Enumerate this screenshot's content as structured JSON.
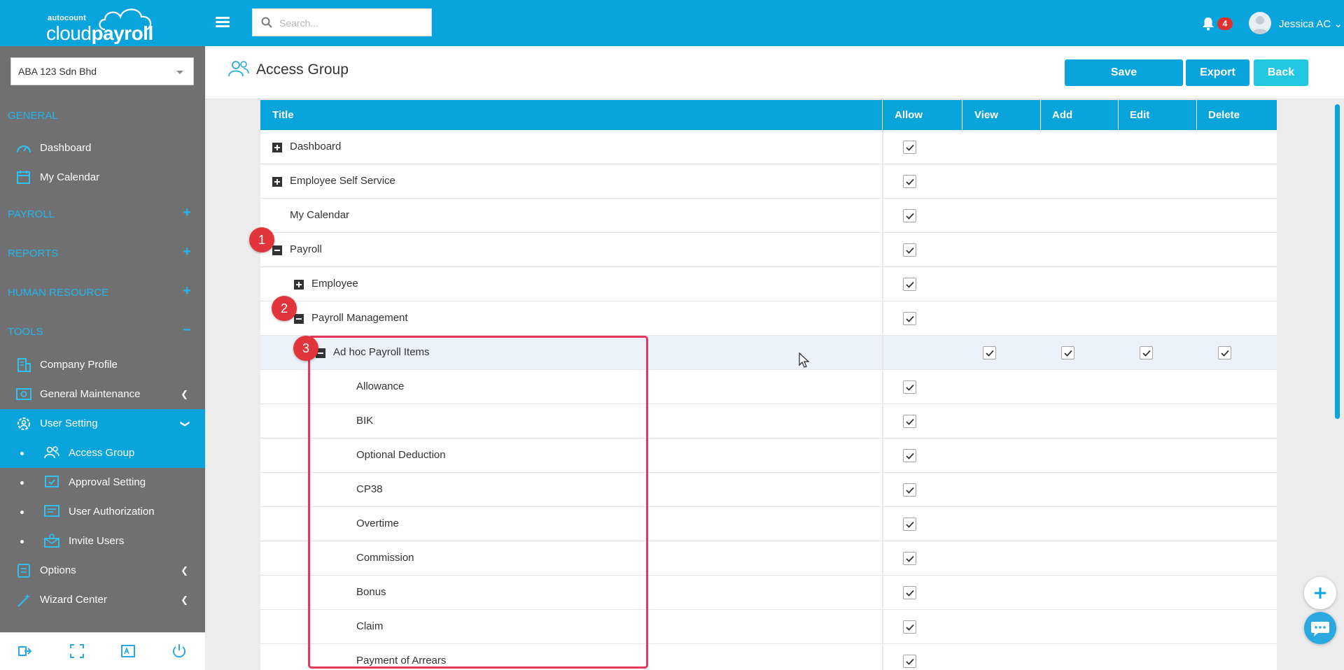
{
  "app": {
    "brand_small": "autocount",
    "brand_main_light": "cloud",
    "brand_main_bold": "payroll",
    "accent_color": "#0aa4dd",
    "sidebar_color": "#707070",
    "callout_color": "#e1343b",
    "highlight_box_color": "#e8365d"
  },
  "topbar": {
    "search_placeholder": "Search...",
    "notification_count": "4",
    "user_name": "Jessica AC"
  },
  "sidebar": {
    "company": "ABA 123 Sdn Bhd",
    "sections": [
      {
        "label": "GENERAL",
        "sign": ""
      },
      {
        "label": "PAYROLL",
        "sign": "+"
      },
      {
        "label": "REPORTS",
        "sign": "+"
      },
      {
        "label": "HUMAN RESOURCE",
        "sign": "+"
      },
      {
        "label": "TOOLS",
        "sign": "−"
      }
    ],
    "items": [
      {
        "label": "Dashboard",
        "icon": "dashboard-icon"
      },
      {
        "label": "My Calendar",
        "icon": "calendar-icon"
      },
      {
        "label": "Company Profile",
        "icon": "building-icon"
      },
      {
        "label": "General Maintenance",
        "icon": "maintenance-icon"
      },
      {
        "label": "User Setting",
        "icon": "user-gear-icon"
      },
      {
        "label": "Options",
        "icon": "options-icon"
      },
      {
        "label": "Wizard Center",
        "icon": "wizard-icon"
      }
    ],
    "subitems": [
      {
        "label": "Access Group",
        "icon": "users-icon"
      },
      {
        "label": "Approval Setting",
        "icon": "approval-icon"
      },
      {
        "label": "User Authorization",
        "icon": "authorization-icon"
      },
      {
        "label": "Invite Users",
        "icon": "invite-icon"
      }
    ]
  },
  "page": {
    "title": "Access Group",
    "buttons": {
      "save": "Save",
      "export": "Export",
      "back": "Back"
    }
  },
  "table": {
    "columns": [
      "Title",
      "Allow",
      "View",
      "Add",
      "Edit",
      "Delete"
    ],
    "rows": [
      {
        "title": "Dashboard",
        "toggle": "plus",
        "allow": true
      },
      {
        "title": "Employee Self Service",
        "toggle": "plus",
        "allow": true
      },
      {
        "title": "My Calendar",
        "toggle": "",
        "allow": true
      },
      {
        "title": "Payroll",
        "toggle": "minus",
        "allow": true
      },
      {
        "title": "Employee",
        "toggle": "plus",
        "allow": true
      },
      {
        "title": "Payroll Management",
        "toggle": "minus",
        "allow": true
      },
      {
        "title": "Ad hoc Payroll Items",
        "toggle": "minus",
        "allow": false,
        "view": true,
        "add": true,
        "edit": true,
        "delete": true
      },
      {
        "title": "Allowance",
        "toggle": "",
        "allow": true
      },
      {
        "title": "BIK",
        "toggle": "",
        "allow": true
      },
      {
        "title": "Optional Deduction",
        "toggle": "",
        "allow": true
      },
      {
        "title": "CP38",
        "toggle": "",
        "allow": true
      },
      {
        "title": "Overtime",
        "toggle": "",
        "allow": true
      },
      {
        "title": "Commission",
        "toggle": "",
        "allow": true
      },
      {
        "title": "Bonus",
        "toggle": "",
        "allow": true
      },
      {
        "title": "Claim",
        "toggle": "",
        "allow": true
      },
      {
        "title": "Payment of Arrears",
        "toggle": "",
        "allow": true
      }
    ]
  },
  "callouts": [
    "1",
    "2",
    "3"
  ]
}
